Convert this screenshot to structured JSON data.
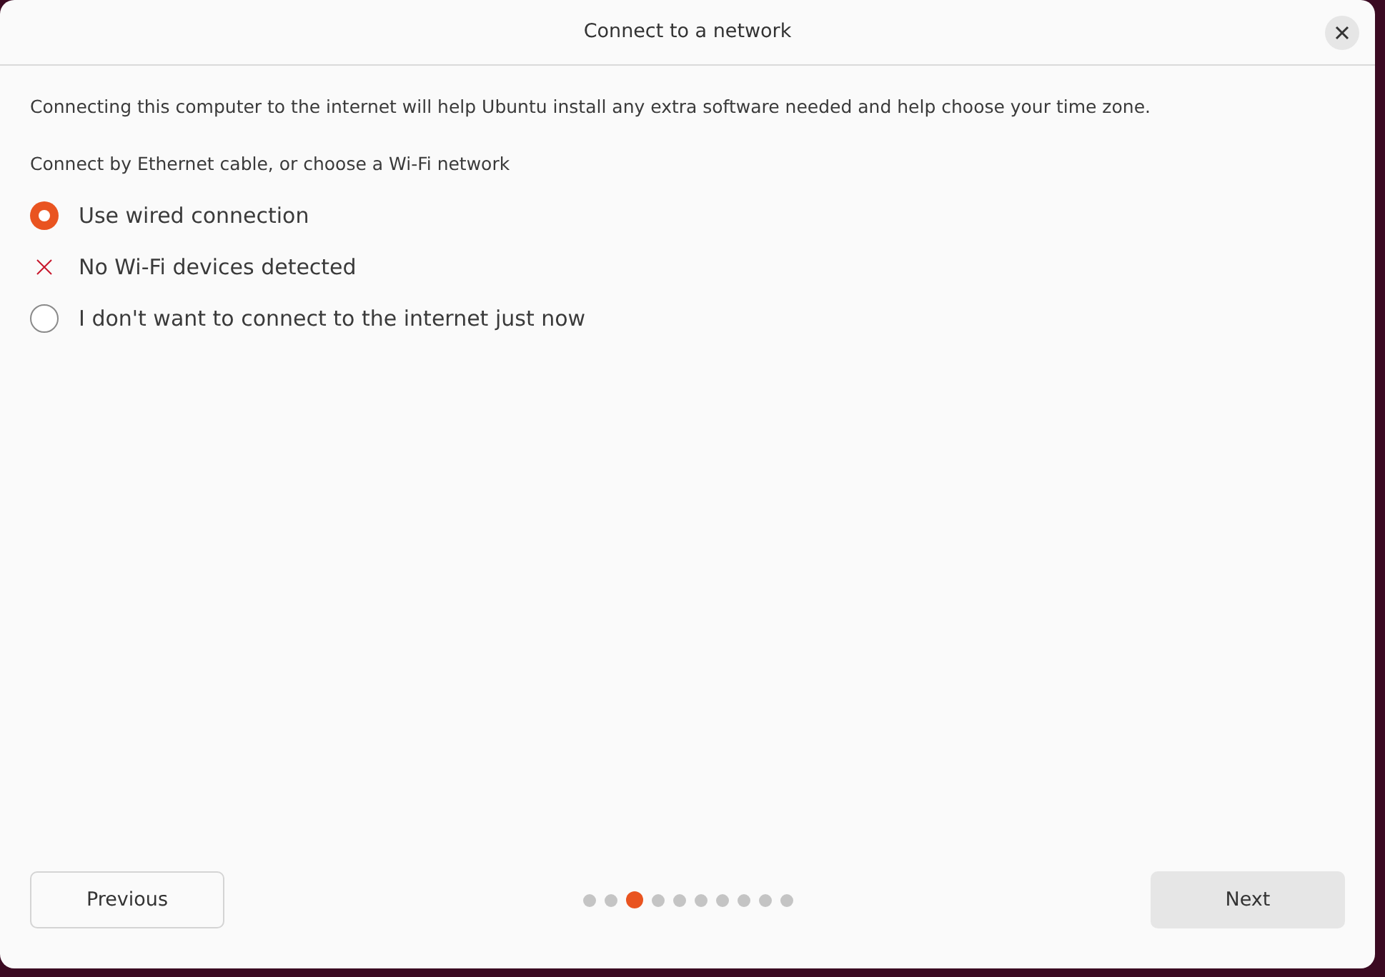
{
  "window": {
    "title": "Connect to a network"
  },
  "intro": "Connecting this computer to the internet will help Ubuntu install any extra software needed and help choose your time zone.",
  "prompt": "Connect by Ethernet cable, or choose a Wi-Fi network",
  "options": [
    {
      "kind": "radio",
      "label": "Use wired connection",
      "selected": true
    },
    {
      "kind": "error",
      "label": "No Wi-Fi devices detected"
    },
    {
      "kind": "radio",
      "label": "I don't want to connect to the internet just now",
      "selected": false
    }
  ],
  "buttons": {
    "previous": "Previous",
    "next": "Next"
  },
  "pages": [
    {
      "selected": false
    },
    {
      "selected": false
    },
    {
      "selected": true
    },
    {
      "selected": false
    },
    {
      "selected": false
    },
    {
      "selected": false
    },
    {
      "selected": false
    },
    {
      "selected": false
    },
    {
      "selected": false
    },
    {
      "selected": false
    }
  ]
}
